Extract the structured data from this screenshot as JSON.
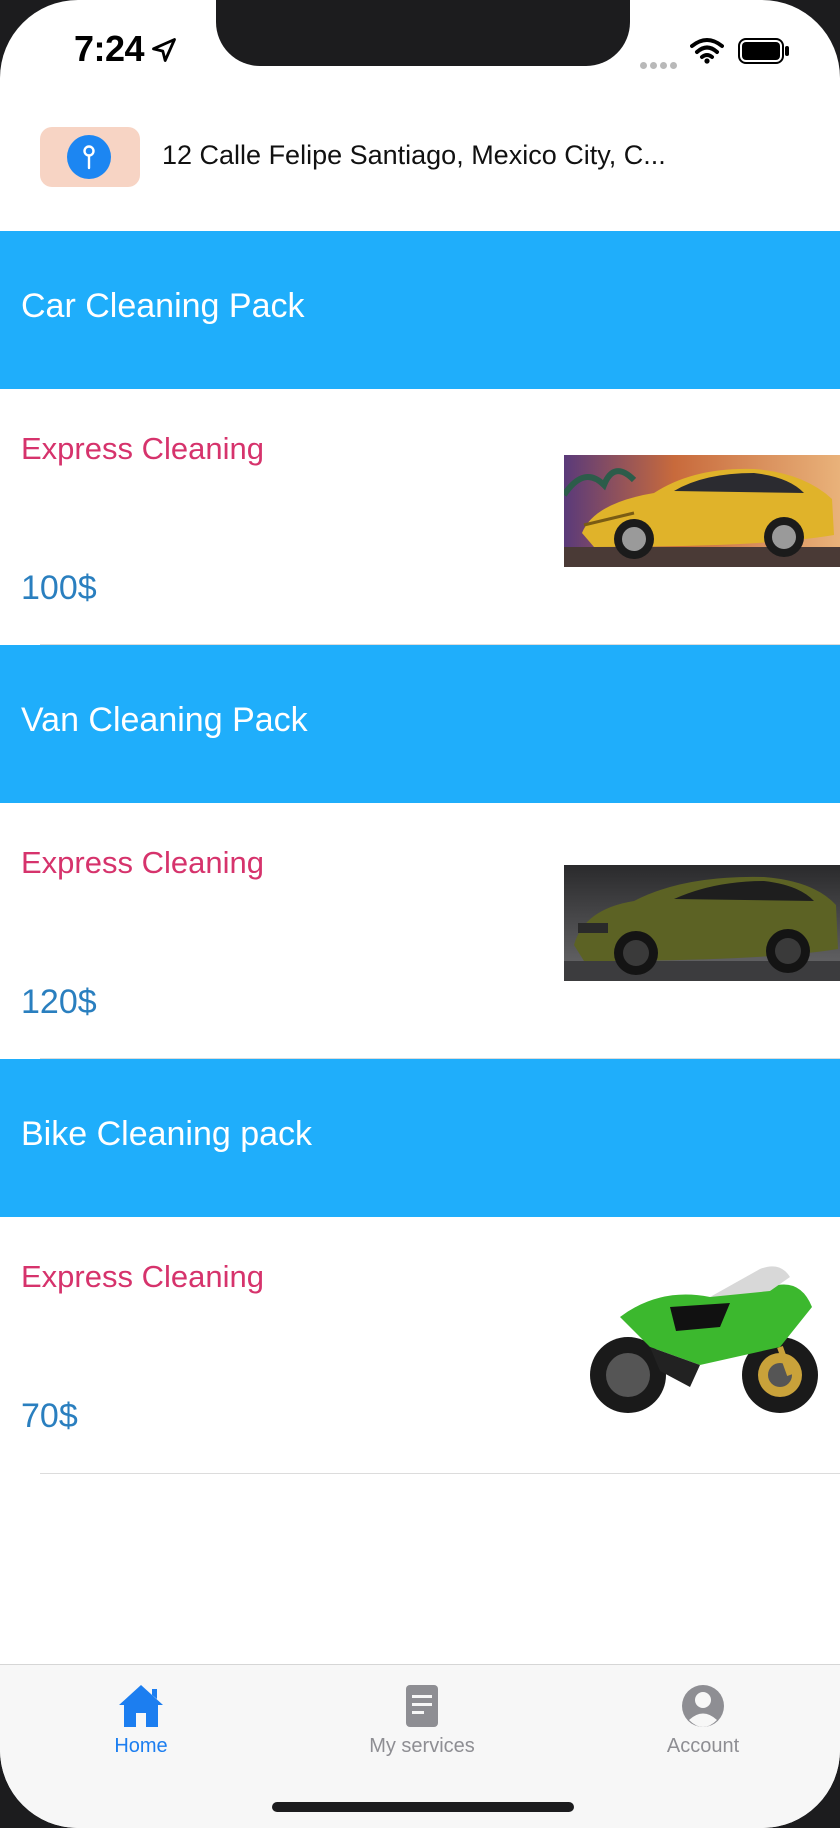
{
  "status_bar": {
    "time": "7:24"
  },
  "address": {
    "text": "12 Calle Felipe Santiago, Mexico City, C..."
  },
  "services": [
    {
      "title": "Car Cleaning Pack",
      "subtitle": "Express Cleaning",
      "price": "100$",
      "image_icon": "yellow-car-image"
    },
    {
      "title": "Van Cleaning Pack",
      "subtitle": "Express Cleaning",
      "price": "120$",
      "image_icon": "green-suv-image"
    },
    {
      "title": "Bike Cleaning pack",
      "subtitle": "Express Cleaning",
      "price": "70$",
      "image_icon": "green-motorcycle-image"
    }
  ],
  "tabs": [
    {
      "label": "Home",
      "icon": "home-icon",
      "active": true
    },
    {
      "label": "My services",
      "icon": "document-icon",
      "active": false
    },
    {
      "label": "Account",
      "icon": "account-icon",
      "active": false
    }
  ],
  "colors": {
    "header_blue": "#1faefb",
    "subtitle_pink": "#d6336c",
    "price_blue": "#2a7fbf",
    "active_tab": "#1c7ef0",
    "pin_chip": "#f7d4c4"
  }
}
